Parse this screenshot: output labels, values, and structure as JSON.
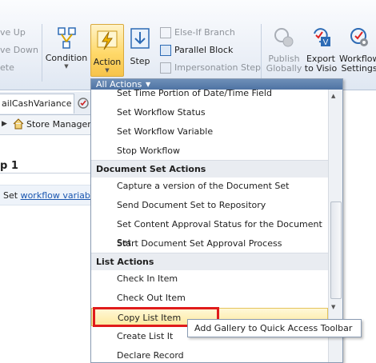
{
  "ribbon": {
    "left_items": {
      "move_up": "ve Up",
      "move_down": "ve Down",
      "delete": "ete"
    },
    "condition": "Condition",
    "action": "Action",
    "step": "Step",
    "else_if_branch": "Else-If Branch",
    "parallel_block": "Parallel Block",
    "impersonation_step": "Impersonation Step",
    "publish_globally": [
      "Publish",
      "Globally"
    ],
    "export_to_visio": [
      "Export",
      "to Visio"
    ],
    "workflow_settings": [
      "Workflow",
      "Settings"
    ]
  },
  "tabs": {
    "workflow_tab": "ailCashVariance"
  },
  "breadcrumb": {
    "store_managers": "Store Managers"
  },
  "editor": {
    "step_heading": "p 1",
    "step_line_prefix": "Set",
    "step_line_link": "workflow variable"
  },
  "menu": {
    "header": "All Actions",
    "items_top": [
      "Set Time Portion of Date/Time Field",
      "Set Workflow Status",
      "Set Workflow Variable",
      "Stop Workflow"
    ],
    "section_document_set": "Document Set Actions",
    "items_docset": [
      "Capture a version of the Document Set",
      "Send Document Set to Repository",
      "Set Content Approval Status for the Document Set",
      "Start Document Set Approval Process"
    ],
    "section_list": "List Actions",
    "items_list": [
      "Check In Item",
      "Check Out Item",
      "Copy List Item",
      "Create List It",
      "Declare Record"
    ]
  },
  "tooltip": "Add Gallery to Quick Access Toolbar",
  "colors": {
    "highlight": "#e01b1b",
    "link": "#1a56b0",
    "menu_header": "#5779a8",
    "action_active": "#ffd96a"
  }
}
